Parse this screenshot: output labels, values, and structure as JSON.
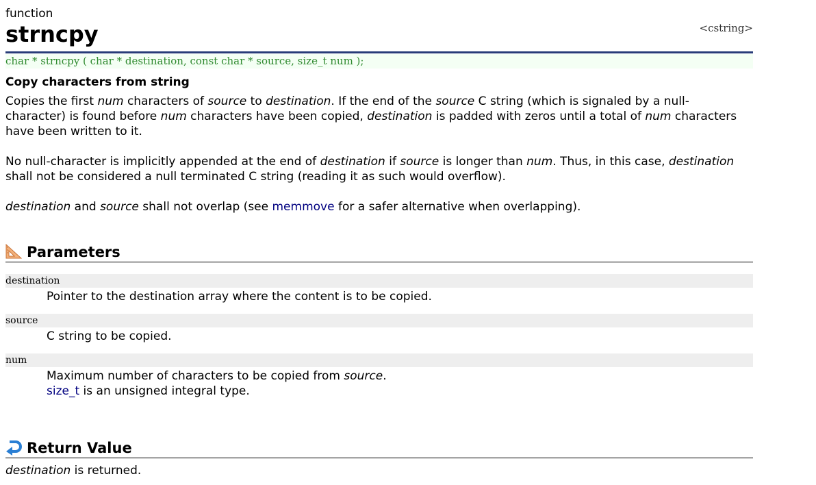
{
  "header": {
    "kind": "function",
    "title": "strncpy",
    "library": "<cstring>"
  },
  "prototype": "char * strncpy ( char * destination, const char * source, size_t num );",
  "short_description": "Copy characters from string",
  "description": {
    "p1": {
      "a": "Copies the first ",
      "b": "num",
      "c": " characters of ",
      "d": "source",
      "e": " to ",
      "f": "destination",
      "g": ". If the end of the ",
      "h": "source",
      "i": " C string (which is signaled by a null-character) is found before ",
      "j": "num",
      "k": " characters have been copied, ",
      "l": "destination",
      "m": " is padded with zeros until a total of ",
      "n": "num",
      "o": " characters have been written to it."
    },
    "p2": {
      "a": "No null-character is implicitly appended at the end of ",
      "b": "destination",
      "c": " if ",
      "d": "source",
      "e": " is longer than ",
      "f": "num",
      "g": ". Thus, in this case, ",
      "h": "destination",
      "i": " shall not be considered a null terminated C string (reading it as such would overflow)."
    },
    "p3": {
      "a": "destination",
      "b": " and ",
      "c": "source",
      "d": " shall not overlap (see ",
      "link": "memmove",
      "e": " for a safer alternative when overlapping)."
    }
  },
  "parameters": {
    "heading": "Parameters",
    "icon": "set-square-icon",
    "items": [
      {
        "name": "destination",
        "desc": "Pointer to the destination array where the content is to be copied."
      },
      {
        "name": "source",
        "desc": "C string to be copied."
      },
      {
        "name": "num",
        "desc_a": "Maximum number of characters to be copied from ",
        "desc_b": "source",
        "desc_c": ".",
        "link": "size_t",
        "desc_d": " is an unsigned integral type."
      }
    ]
  },
  "return_value": {
    "heading": "Return Value",
    "icon": "return-arrow-icon",
    "a": "destination",
    "b": " is returned."
  },
  "colors": {
    "title_rule": "#283c78",
    "prototype_text": "#2f8a2f",
    "prototype_bg": "#f4fff4",
    "link": "#000080",
    "param_bg": "#eeeeee"
  }
}
